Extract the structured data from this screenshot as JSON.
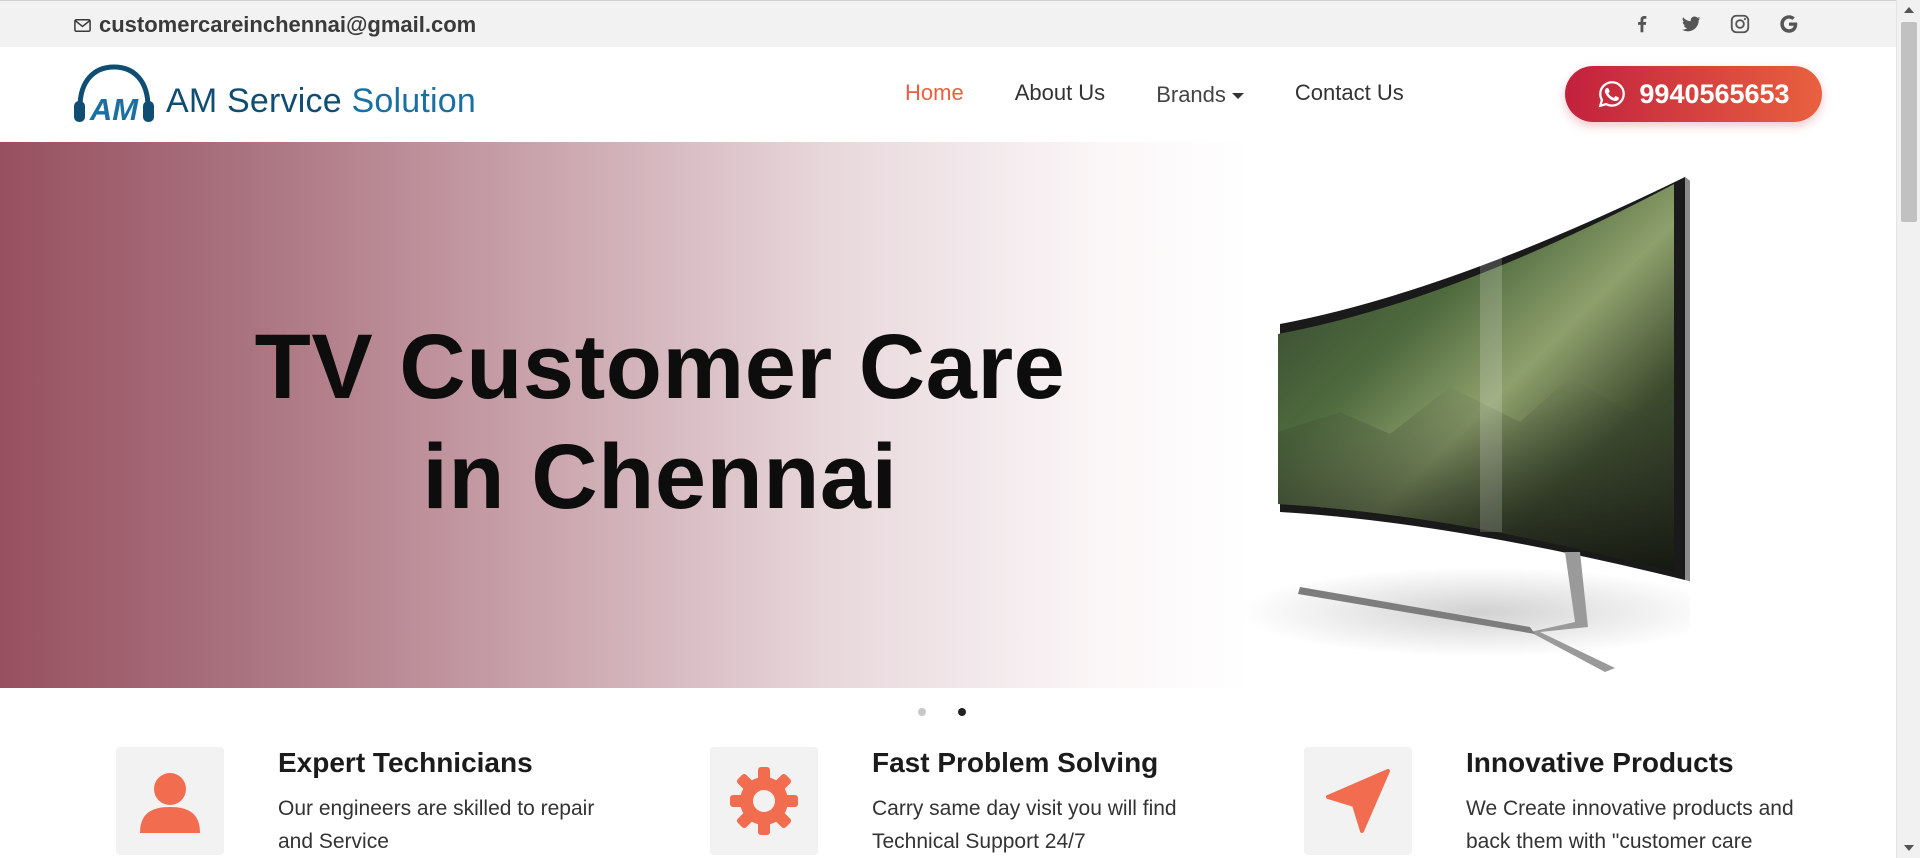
{
  "topbar": {
    "email": "customercareinchennai@gmail.com",
    "social_icons": [
      "facebook-icon",
      "twitter-icon",
      "instagram-icon",
      "google-icon"
    ]
  },
  "logo": {
    "mark": "AM",
    "name_part1": "AM Service",
    "name_part2": "Solution"
  },
  "nav": {
    "items": [
      {
        "label": "Home",
        "active": true
      },
      {
        "label": "About Us",
        "active": false
      },
      {
        "label": "Brands",
        "active": false,
        "dropdown": true
      },
      {
        "label": "Contact Us",
        "active": false
      }
    ]
  },
  "call_button": {
    "phone": "9940565653",
    "icon": "whatsapp-icon"
  },
  "hero": {
    "title_line1": "TV Customer Care",
    "title_line2": "in Chennai",
    "slides": 2,
    "active_slide": 2
  },
  "features": [
    {
      "icon": "user-icon",
      "title": "Expert Technicians",
      "text": "Our engineers are skilled to repair and Service"
    },
    {
      "icon": "gear-icon",
      "title": "Fast Problem Solving",
      "text": "Carry same day visit you will find Technical Support 24/7"
    },
    {
      "icon": "navigation-arrow-icon",
      "title": "Innovative Products",
      "text": "We Create innovative products and back them with \"customer care"
    }
  ],
  "colors": {
    "accent": "#e8613f",
    "brand_blue": "#0f4d73",
    "button_start": "#c2213d",
    "button_end": "#e8613f",
    "hero_left": "#98505f"
  }
}
